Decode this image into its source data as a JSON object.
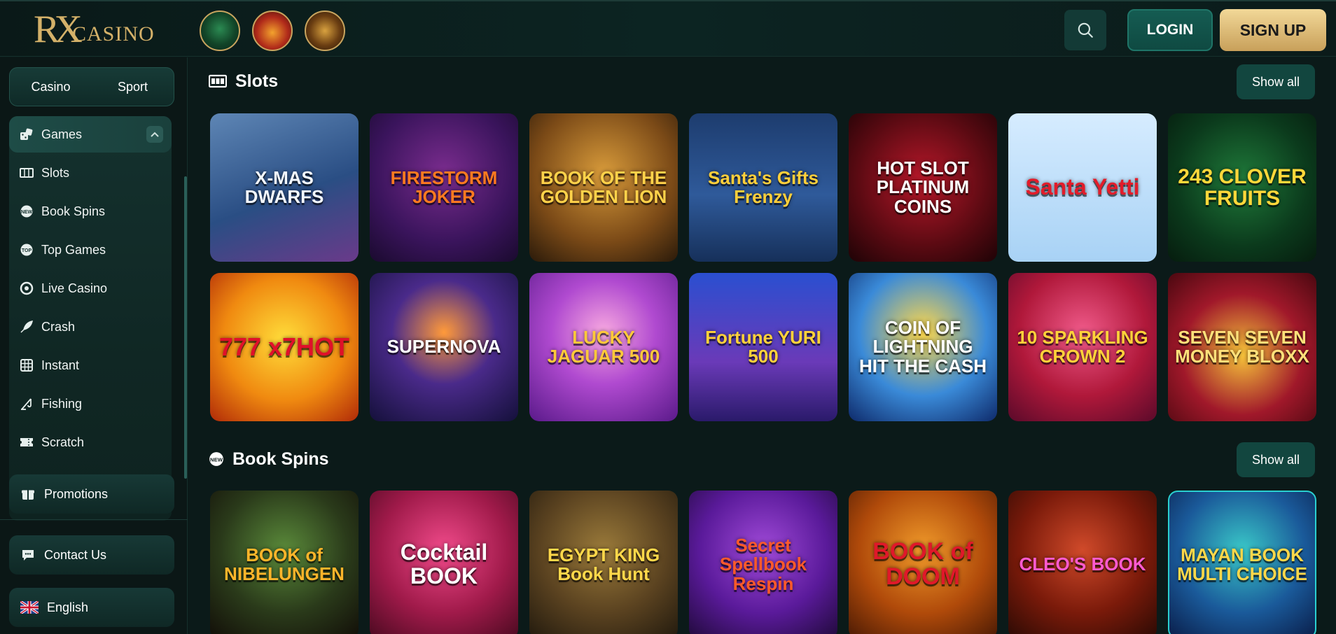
{
  "header": {
    "logo_rx": "RX",
    "logo_text": "CASINO",
    "promos": [
      "scarab-promo",
      "joker-promo",
      "treasure-chest-promo"
    ],
    "login_label": "LOGIN",
    "signup_label": "SIGN UP"
  },
  "sidebar": {
    "toggle": [
      "Casino",
      "Sport"
    ],
    "items": [
      {
        "label": "Games",
        "icon": "games-icon"
      },
      {
        "label": "Slots",
        "icon": "slots-icon"
      },
      {
        "label": "Book Spins",
        "icon": "book-spins-icon"
      },
      {
        "label": "Top Games",
        "icon": "top-games-icon"
      },
      {
        "label": "Live Casino",
        "icon": "live-casino-icon"
      },
      {
        "label": "Crash",
        "icon": "crash-icon"
      },
      {
        "label": "Instant",
        "icon": "instant-icon"
      },
      {
        "label": "Fishing",
        "icon": "fishing-icon"
      },
      {
        "label": "Scratch",
        "icon": "scratch-icon"
      }
    ],
    "promotions": "Promotions",
    "contact": "Contact Us",
    "language": "English"
  },
  "sections": [
    {
      "title": "Slots",
      "show_all": "Show all",
      "games": [
        "X-MAS DWARFS",
        "FIRESTORM JOKER",
        "BOOK OF THE GOLDEN LION",
        "Santa's Gifts Frenzy",
        "HOT SLOT PLATINUM COINS",
        "Santa Yetti",
        "243 CLOVER FRUITS",
        "777 x7HOT",
        "SUPERNOVA",
        "LUCKY JAGUAR 500",
        "Fortune YURI 500",
        "COIN OF LIGHTNING HIT THE CASH",
        "10 SPARKLING CROWN 2",
        "SEVEN SEVEN MONEY BLOXX"
      ]
    },
    {
      "title": "Book Spins",
      "show_all": "Show all",
      "games": [
        "BOOK of NIBELUNGEN",
        "Cocktail BOOK",
        "EGYPT KING Book Hunt",
        "Secret Spellbook Respin",
        "BOOK of DOOM",
        "CLEO'S BOOK",
        "MAYAN BOOK MULTI CHOICE"
      ]
    }
  ],
  "colors": {
    "background": "#0b1a19",
    "accent_gold": "#d4b169",
    "button_teal": "#12463f"
  }
}
